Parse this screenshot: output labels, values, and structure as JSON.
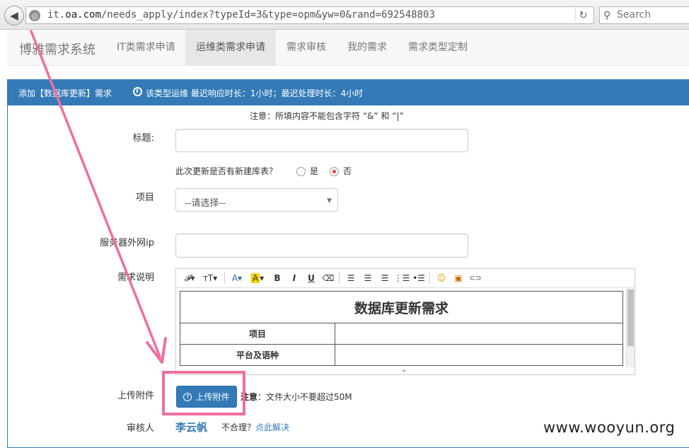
{
  "browser": {
    "url_prefix": "it.",
    "url_domain": "oa.com",
    "url_path": "/needs_apply/index?typeId=3&type=opm&yw=0&rand=692548803",
    "search_placeholder": "Search"
  },
  "navbar": {
    "brand": "博雅需求系统",
    "items": [
      {
        "label": "IT类需求申请"
      },
      {
        "label": "运维类需求申请"
      },
      {
        "label": "需求审核"
      },
      {
        "label": "我的需求"
      },
      {
        "label": "需求类型定制"
      }
    ],
    "active_index": 1
  },
  "panel": {
    "title": "添加【数据库更新】需求",
    "sla": "该类型运维 最迟响应时长：1小时；最迟处理时长：4小时"
  },
  "form": {
    "notice": "注意：所填内容不能包含字符 “&” 和 “|”",
    "title_label": "标题:",
    "title_value": "",
    "new_table_question": "此次更新是否有新建库表？",
    "radio_yes": "是",
    "radio_no": "否",
    "radio_selected": "否",
    "project_label": "项目",
    "project_value": "--请选择--",
    "server_ip_label": "服务器外网ip",
    "server_ip_value": "",
    "description_label": "需求说明",
    "upload_label": "上传附件",
    "upload_button": "上传附件",
    "upload_note_strong": "注意",
    "upload_note_rest": "：文件大小不要超过50M",
    "reviewer_label": "审核人",
    "reviewer_name": "李云帆",
    "unreasonable_text": "不合理？",
    "resolve_link": "点此解决"
  },
  "editor": {
    "toolbar": {
      "font_family": "𝓕",
      "font_size": "тT",
      "font_color": "A",
      "highlight": "A",
      "bold": "B",
      "italic": "I",
      "underline": "U",
      "eraser": "⌫",
      "emoji": "☺",
      "image": "▣",
      "link": "⊂⊃"
    },
    "doc": {
      "heading": "数据库更新需求",
      "rows": [
        {
          "label": "项目",
          "value": ""
        },
        {
          "label": "平台及语种",
          "value": ""
        }
      ]
    }
  },
  "watermark": "www.wooyun.org",
  "annotation_color": "#f06ea0"
}
